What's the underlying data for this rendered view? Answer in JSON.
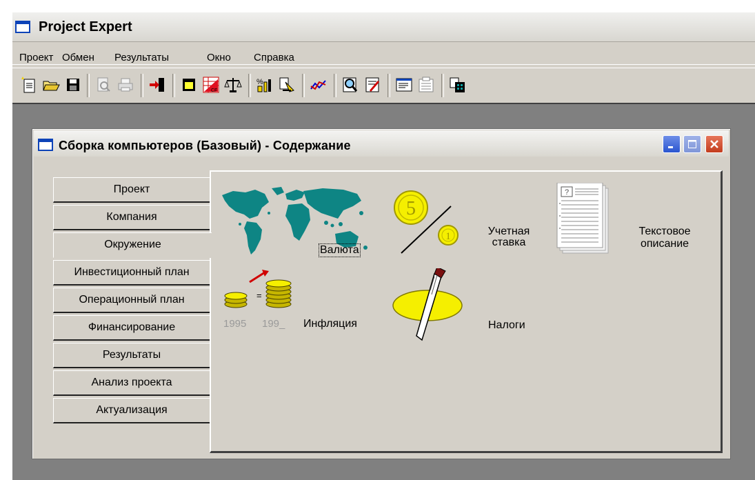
{
  "app": {
    "title": "Project Expert"
  },
  "menu": [
    "Проект",
    "Обмен",
    "Результаты",
    "Окно",
    "Справка"
  ],
  "toolbar": [
    {
      "name": "new-project-icon"
    },
    {
      "name": "open-icon"
    },
    {
      "name": "save-icon"
    },
    {
      "name": "print-preview-icon"
    },
    {
      "name": "print-icon"
    },
    {
      "name": "exit-icon"
    },
    {
      "name": "table-icon"
    },
    {
      "name": "cash-flow-icon"
    },
    {
      "name": "balance-icon"
    },
    {
      "name": "percent-chart-icon"
    },
    {
      "name": "import-icon"
    },
    {
      "name": "line-chart-icon"
    },
    {
      "name": "analysis-icon"
    },
    {
      "name": "report-icon"
    },
    {
      "name": "text-window-icon"
    },
    {
      "name": "document-icon"
    },
    {
      "name": "calculator-icon"
    }
  ],
  "child_window": {
    "title": "Сборка компьютеров (Базовый) - Содержание"
  },
  "tabs": [
    {
      "label": "Проект"
    },
    {
      "label": "Компания"
    },
    {
      "label": "Окружение",
      "active": true
    },
    {
      "label": "Инвестиционный план"
    },
    {
      "label": "Операционный план"
    },
    {
      "label": "Финансирование"
    },
    {
      "label": "Результаты"
    },
    {
      "label": "Анализ проекта"
    },
    {
      "label": "Актуализация"
    }
  ],
  "items": {
    "currency": "Валюта",
    "discount_line1": "Учетная",
    "discount_line2": "ставка",
    "text_line1": "Текстовое",
    "text_line2": "описание",
    "inflation": "Инфляция",
    "year_1": "1995",
    "year_2": "199_",
    "taxes": "Налоги",
    "coin_big": "5",
    "coin_small": "1"
  },
  "colors": {
    "face": "#d4d0c8",
    "workspace": "#808080",
    "map_teal": "#0e8584",
    "coin_yellow": "#f5ef00",
    "xp_blue": "#0d43b8",
    "close_red": "#c33c1d"
  }
}
